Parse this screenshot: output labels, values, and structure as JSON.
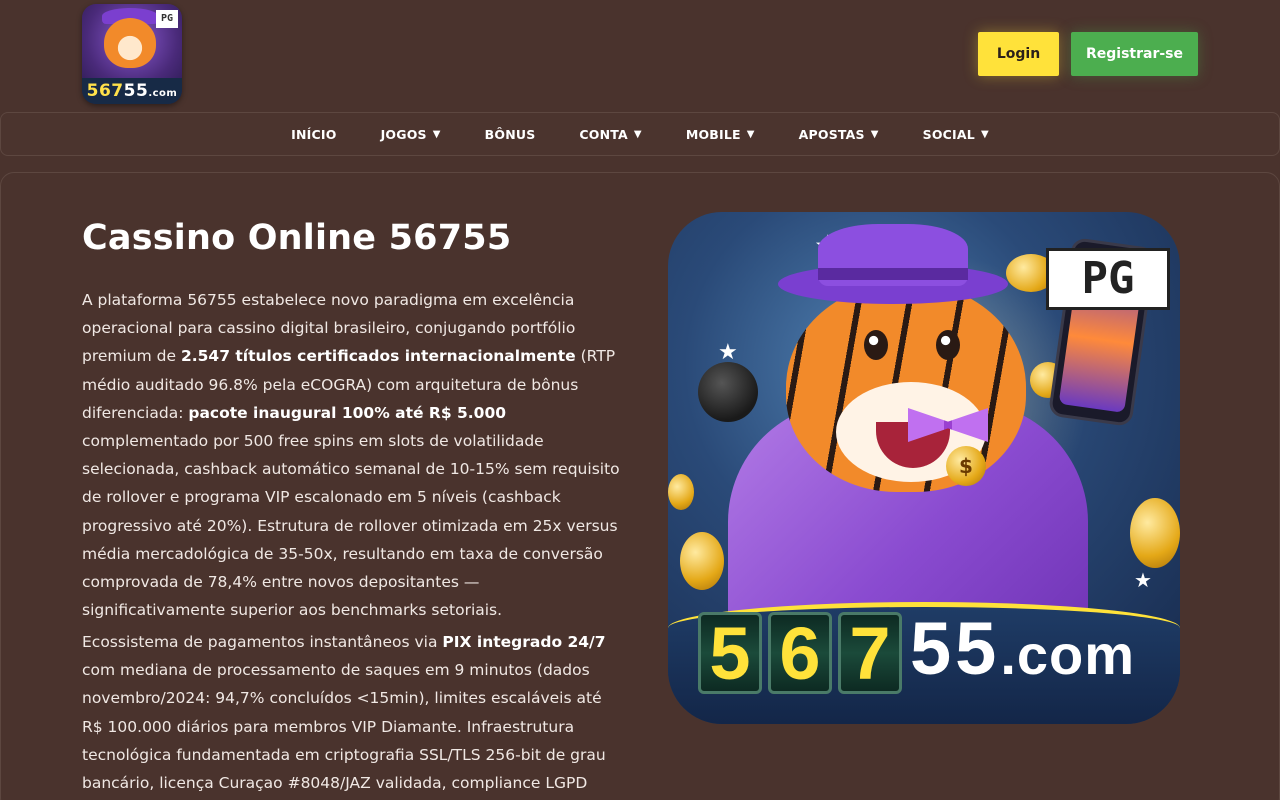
{
  "header": {
    "logo": {
      "badge": "PG",
      "digits": "567",
      "digits2": "55",
      "suffix": ".com"
    },
    "login_label": "Login",
    "register_label": "Registrar-se"
  },
  "nav": {
    "items": [
      {
        "label": "INÍCIO",
        "dropdown": false
      },
      {
        "label": "JOGOS",
        "dropdown": true
      },
      {
        "label": "BÔNUS",
        "dropdown": false
      },
      {
        "label": "CONTA",
        "dropdown": true
      },
      {
        "label": "MOBILE",
        "dropdown": true
      },
      {
        "label": "APOSTAS",
        "dropdown": true
      },
      {
        "label": "SOCIAL",
        "dropdown": true
      }
    ],
    "caret": "▼"
  },
  "main": {
    "title": "Cassino Online 56755",
    "para1": {
      "t1": "A plataforma 56755 estabelece novo paradigma em excelência operacional para cassino digital brasileiro, conjugando portfólio premium de ",
      "b1": "2.547 títulos certificados internacionalmente",
      "t2": " (RTP médio auditado 96.8% pela eCOGRA) com arquitetura de bônus diferenciada: ",
      "b2": "pacote inaugural 100% até R$ 5.000",
      "t3": " complementado por 500 free spins em slots de volatilidade selecionada, cashback automático semanal de 10-15% sem requisito de rollover e programa VIP escalonado em 5 níveis (cashback progressivo até 20%). Estrutura de rollover otimizada em 25x versus média mercadológica de 35-50x, resultando em taxa de conversão comprovada de 78,4% entre novos depositantes — significativamente superior aos benchmarks setoriais."
    },
    "para2": {
      "t1": "Ecossistema de pagamentos instantâneos via ",
      "b1": "PIX integrado 24/7",
      "t2": " com mediana de processamento de saques em 9 minutos (dados novembro/2024: 94,7% concluídos <15min), limites escaláveis até R$ 100.000 diários para membros VIP Diamante. Infraestrutura tecnológica fundamentada em criptografia SSL/TLS 256-bit de grau bancário, licença Curaçao #8048/JAZ validada, compliance LGPD"
    }
  },
  "hero": {
    "pg_mark": "PG",
    "coin_symbol": "$",
    "digit1": "5",
    "digit2": "6",
    "digit3": "7",
    "rest": "55",
    "suffix": ".com"
  },
  "colors": {
    "background": "#4a332d",
    "login": "#ffe23a",
    "register": "#4cae4f",
    "text": "#f0e8e4"
  }
}
